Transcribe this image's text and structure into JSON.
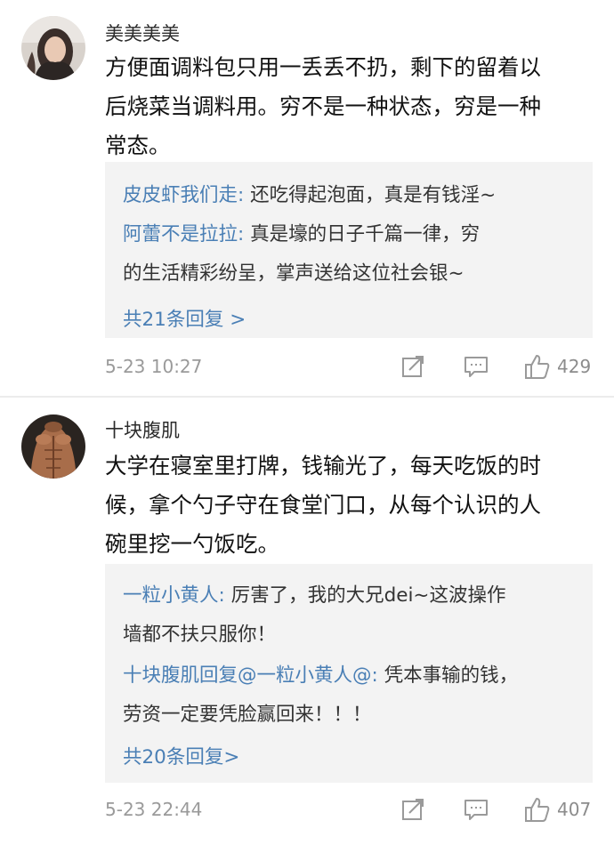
{
  "comments": [
    {
      "username": "美美美美",
      "content_lines": [
        "方便面调料包只用一丢丢不扔，剩下的留着以",
        "后烧菜当调料用。穷不是一种状态，穷是一种",
        "常态。"
      ],
      "replies": [
        {
          "user": "皮皮虾我们走:",
          "text": " 还吃得起泡面，真是有钱淫~"
        },
        {
          "user": "阿蕾不是拉拉:",
          "text": " 真是壕的日子千篇一律，穷"
        }
      ],
      "reply_continuation": "的生活精彩纷呈，掌声送给这位社会银~",
      "more_replies": "共21条回复 >",
      "time": "5-23  10:27",
      "likes": "429"
    },
    {
      "username": "十块腹肌",
      "content_lines": [
        "大学在寝室里打牌，钱输光了，每天吃饭的时",
        "候，拿个勺子守在食堂门口，从每个认识的人",
        "碗里挖一勺饭吃。"
      ],
      "replies": [
        {
          "user": "一粒小黄人:",
          "text": " 厉害了，我的大兄dei~这波操作"
        },
        {
          "user": "十块腹肌回复@一粒小黄人@:",
          "text": " 凭本事输的钱，"
        }
      ],
      "reply1_continuation": "墙都不扶只服你！",
      "reply2_continuation": "劳资一定要凭脸赢回来！！！",
      "more_replies": "共20条回复>",
      "time": "5-23  22:44",
      "likes": "407"
    }
  ],
  "icons": {
    "share": "share-icon",
    "comment": "comment-icon",
    "like": "thumbs-up-icon"
  },
  "colors": {
    "username_link": "#4a7fb5",
    "reply_bg": "#f3f3f3",
    "meta": "#9a9a9a"
  }
}
